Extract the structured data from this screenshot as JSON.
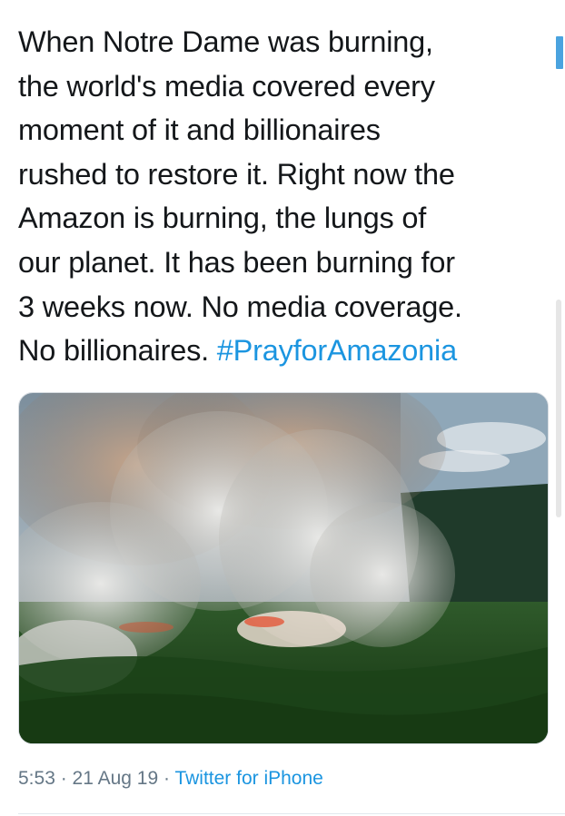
{
  "tweet": {
    "lines": [
      "When Notre Dame was burning,",
      "the world's media covered every",
      "moment of it and billionaires",
      "rushed to restore it. Right now the",
      "Amazon is burning, the lungs of",
      "our planet. It has been burning for",
      "3 weeks now. No media coverage."
    ],
    "last_line_text": "No billionaires. ",
    "hashtag": "#PrayforAmazonia"
  },
  "media": {
    "icon": "photo-image",
    "description": "Aerial photo of Amazon rainforest fire with smoke plumes"
  },
  "meta": {
    "time": "5:53",
    "separator": " · ",
    "date": "21 Aug 19",
    "source": "Twitter for iPhone"
  },
  "colors": {
    "text": "#14171a",
    "link": "#1b95e0",
    "muted": "#657786"
  }
}
